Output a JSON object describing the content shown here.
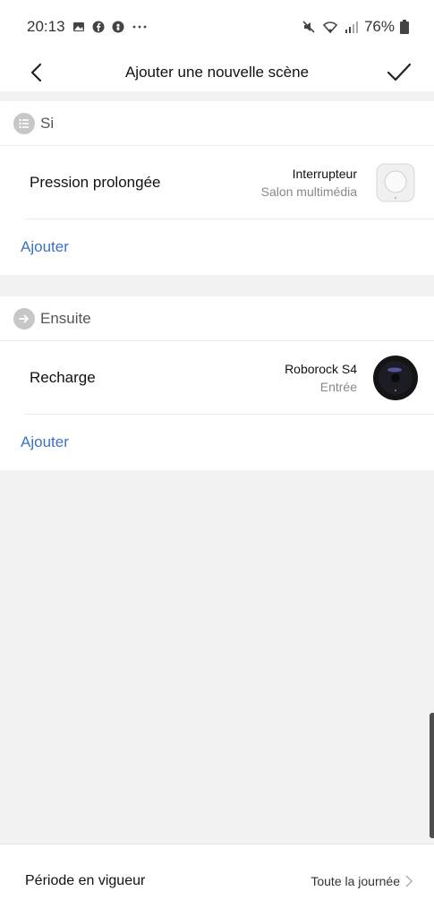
{
  "status": {
    "time": "20:13",
    "battery": "76%",
    "icons": [
      "gallery-icon",
      "facebook-icon",
      "messenger-icon",
      "more-icon",
      "mute-icon",
      "wifi-icon",
      "signal-icon",
      "battery-icon"
    ]
  },
  "nav": {
    "title": "Ajouter une nouvelle scène",
    "back_icon": "chevron-left-icon",
    "confirm_icon": "check-icon"
  },
  "if_section": {
    "label": "Si",
    "icon": "list-icon",
    "item": {
      "label": "Pression prolongée",
      "device_name": "Interrupteur",
      "device_room": "Salon multimédia",
      "device_icon": "wireless-switch-icon"
    },
    "add_label": "Ajouter"
  },
  "then_section": {
    "label": "Ensuite",
    "icon": "arrow-right-icon",
    "item": {
      "label": "Recharge",
      "device_name": "Roborock S4",
      "device_room": "Entrée",
      "device_icon": "robot-vacuum-icon"
    },
    "add_label": "Ajouter"
  },
  "footer": {
    "label": "Période en vigueur",
    "value": "Toute la journée"
  },
  "colors": {
    "accent": "#3c72c5",
    "background": "#f2f2f2"
  }
}
